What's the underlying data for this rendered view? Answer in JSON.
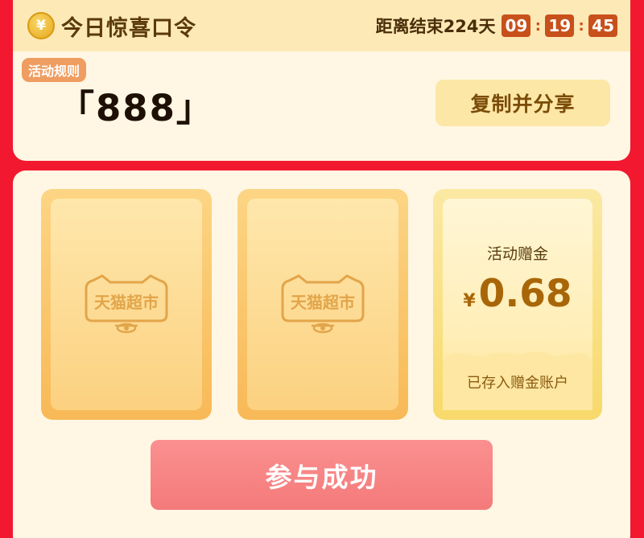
{
  "header": {
    "coin_symbol": "¥",
    "title": "今日惊喜口令",
    "countdown_label": "距离结束224天",
    "countdown": {
      "hours": "09",
      "minutes": "19",
      "seconds": "45"
    }
  },
  "code_section": {
    "rules_tag": "活动规则",
    "code": "「888」",
    "copy_button": "复制并分享"
  },
  "cards": [
    {
      "brand": "天猫超市"
    },
    {
      "brand": "天猫超市"
    },
    {
      "bonus_label": "活动赠金",
      "currency": "¥",
      "amount": "0.68",
      "status": "已存入赠金账户"
    }
  ],
  "join_button": "参与成功",
  "colors": {
    "background_red": "#f2182f",
    "card_cream": "#fff7e4",
    "timer_box": "#c8501b",
    "accent_gold": "#a86608",
    "join_button": "#f47a7a"
  }
}
